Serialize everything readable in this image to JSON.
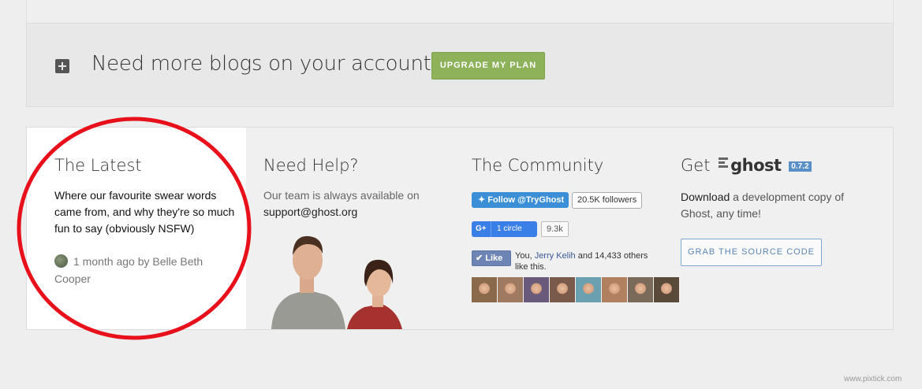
{
  "upgrade": {
    "text": "Need more blogs on your account?",
    "button_label": "UPGRADE MY PLAN",
    "icon": "plus-square-icon"
  },
  "latest": {
    "title": "The Latest",
    "description": "Where our favourite swear words came from, and why they're so much fun to say (obviously NSFW)",
    "meta": "1 month ago by Belle Beth Cooper"
  },
  "help": {
    "title": "Need Help?",
    "text": "Our team is always available on",
    "email": "support@ghost.org"
  },
  "community": {
    "title": "The Community",
    "twitter": {
      "label": "Follow @TryGhost",
      "count": "20.5K followers"
    },
    "google": {
      "label": "1 circle",
      "count": "9.3k",
      "glyph": "G+"
    },
    "facebook": {
      "label": "Like",
      "text_pre": "You, ",
      "link": "Jerry Kelih",
      "text_post": " and 14,433 others like this."
    },
    "face_colors": [
      "#8a6a4a",
      "#a07a60",
      "#6a5a7a",
      "#7a5a4a",
      "#6aa0b0",
      "#b08060",
      "#7a6a5a",
      "#5a4a3a"
    ]
  },
  "ghost": {
    "title_prefix": "Get",
    "logo": "ghost",
    "version": "0.7.2",
    "text_bold": "Download",
    "text": " a development copy of Ghost, any time!",
    "button_label": "GRAB THE SOURCE CODE"
  },
  "watermark": "www.pixtick.com",
  "colors": {
    "upgrade_button": "#8db25a",
    "twitter": "#3a8fd7",
    "google": "#3a7ee8",
    "facebook": "#6d84b4",
    "annotation_circle": "#e8101a"
  }
}
